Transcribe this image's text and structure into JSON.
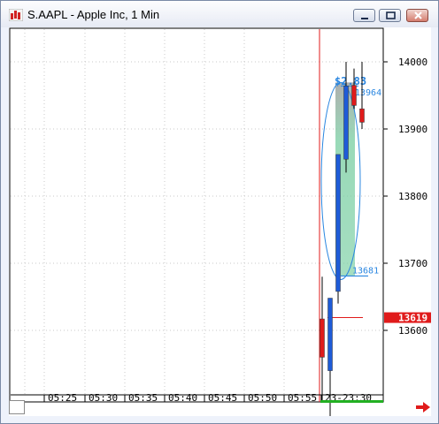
{
  "window": {
    "title": "S.AAPL - Apple Inc, 1 Min",
    "minimize_label": "minimize",
    "maximize_label": "maximize",
    "close_label": "close"
  },
  "price_axis": {
    "labels": [
      {
        "price": 140.0,
        "text": "14000"
      },
      {
        "price": 139.0,
        "text": "13900"
      },
      {
        "price": 138.0,
        "text": "13800"
      },
      {
        "price": 137.0,
        "text": "13700"
      },
      {
        "price": 136.0,
        "text": "13600"
      }
    ],
    "current_price": {
      "price": 136.19,
      "text": "13619"
    }
  },
  "time_axis": {
    "labels": [
      "05:25",
      "05:30",
      "05:35",
      "05:40",
      "05:45",
      "05:50",
      "05:55",
      "23-23:30"
    ]
  },
  "measure": {
    "delta_label": "$2.83",
    "high": {
      "price": 139.64,
      "text": "13964"
    },
    "low": {
      "price": 136.81,
      "text": "13681"
    }
  },
  "chart_data": {
    "type": "candlestick",
    "symbol": "S.AAPL",
    "interval": "1 Min",
    "ylim": [
      135.0,
      140.7
    ],
    "candles": [
      {
        "open": 136.17,
        "high": 136.8,
        "low": 134.95,
        "close": 135.6,
        "color": "red"
      },
      {
        "open": 135.4,
        "high": 136.48,
        "low": 134.52,
        "close": 136.48,
        "color": "blue"
      },
      {
        "open": 136.58,
        "high": 136.8,
        "low": 136.4,
        "close": 138.62,
        "color": "blue"
      },
      {
        "open": 138.55,
        "high": 140.0,
        "low": 138.35,
        "close": 139.64,
        "color": "blue"
      },
      {
        "open": 139.65,
        "high": 139.9,
        "low": 139.3,
        "close": 139.35,
        "color": "red"
      },
      {
        "open": 139.3,
        "high": 140.0,
        "low": 139.0,
        "close": 139.1,
        "color": "red"
      }
    ],
    "colors": {
      "up": "#1e5bd8",
      "down": "#e01b1b",
      "measure": "#2a86e0",
      "fill": "#7fd0a6",
      "session_line": "#e01b1b",
      "current_price_bg": "#e01b1b"
    }
  }
}
